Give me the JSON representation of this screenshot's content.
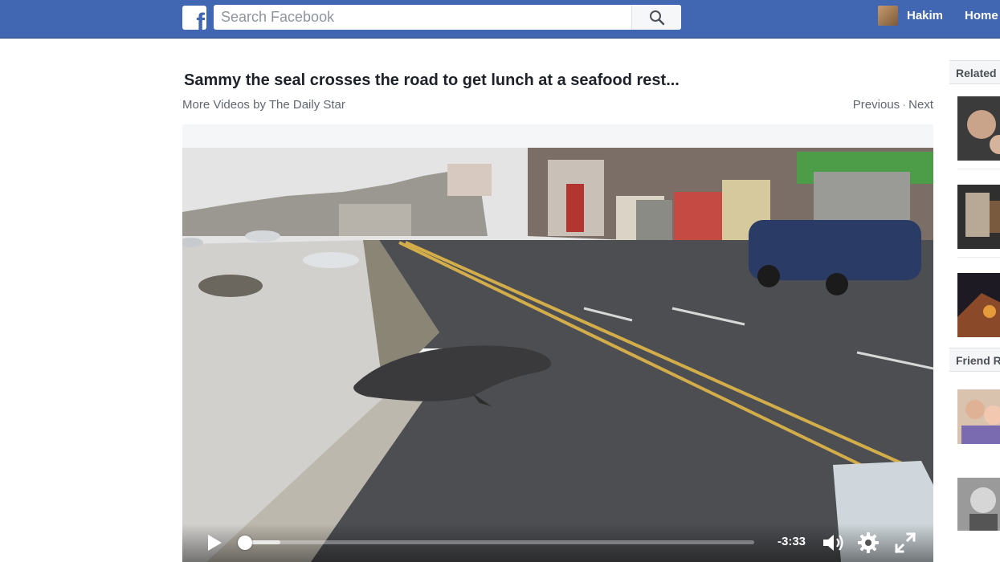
{
  "header": {
    "logo_letter": "f",
    "search_placeholder": "Search Facebook",
    "user_name": "Hakim",
    "home_label": "Home"
  },
  "video_page": {
    "title": "Sammy the seal crosses the road to get lunch at a seafood rest...",
    "more_videos_label": "More Videos by The Daily Star",
    "previous_label": "Previous",
    "separator": "·",
    "next_label": "Next"
  },
  "player": {
    "time_remaining": "-3:33",
    "played_fraction": 0.0,
    "buffered_fraction": 0.08
  },
  "sidebar": {
    "related_heading": "Related",
    "friend_heading": "Friend R"
  },
  "colors": {
    "topbar": "#4267b2",
    "title_text": "#1d2129",
    "secondary_text": "#606770"
  }
}
